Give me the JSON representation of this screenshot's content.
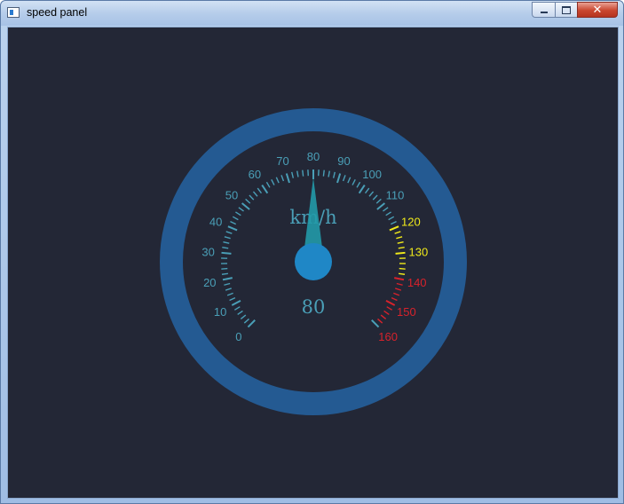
{
  "window": {
    "title": "speed panel",
    "close_glyph": "✕"
  },
  "gauge": {
    "min": 0,
    "max": 160,
    "major_step": 10,
    "value": 80,
    "unit": "km/h",
    "value_text": "80",
    "scale_labels": [
      "0",
      "10",
      "20",
      "30",
      "40",
      "50",
      "60",
      "70",
      "80",
      "90",
      "100",
      "110",
      "120",
      "130",
      "140",
      "150",
      "160"
    ],
    "colors": {
      "background": "#232736",
      "outer_ring": "#245a92",
      "normal": "#4a9fb7",
      "warning": "#f0ea1a",
      "danger": "#d8222b",
      "needle": "#229aa8",
      "hub": "#1f87c6",
      "text": "#4a9fb7"
    },
    "warning_range": [
      120,
      140
    ],
    "danger_range": [
      140,
      160
    ]
  }
}
